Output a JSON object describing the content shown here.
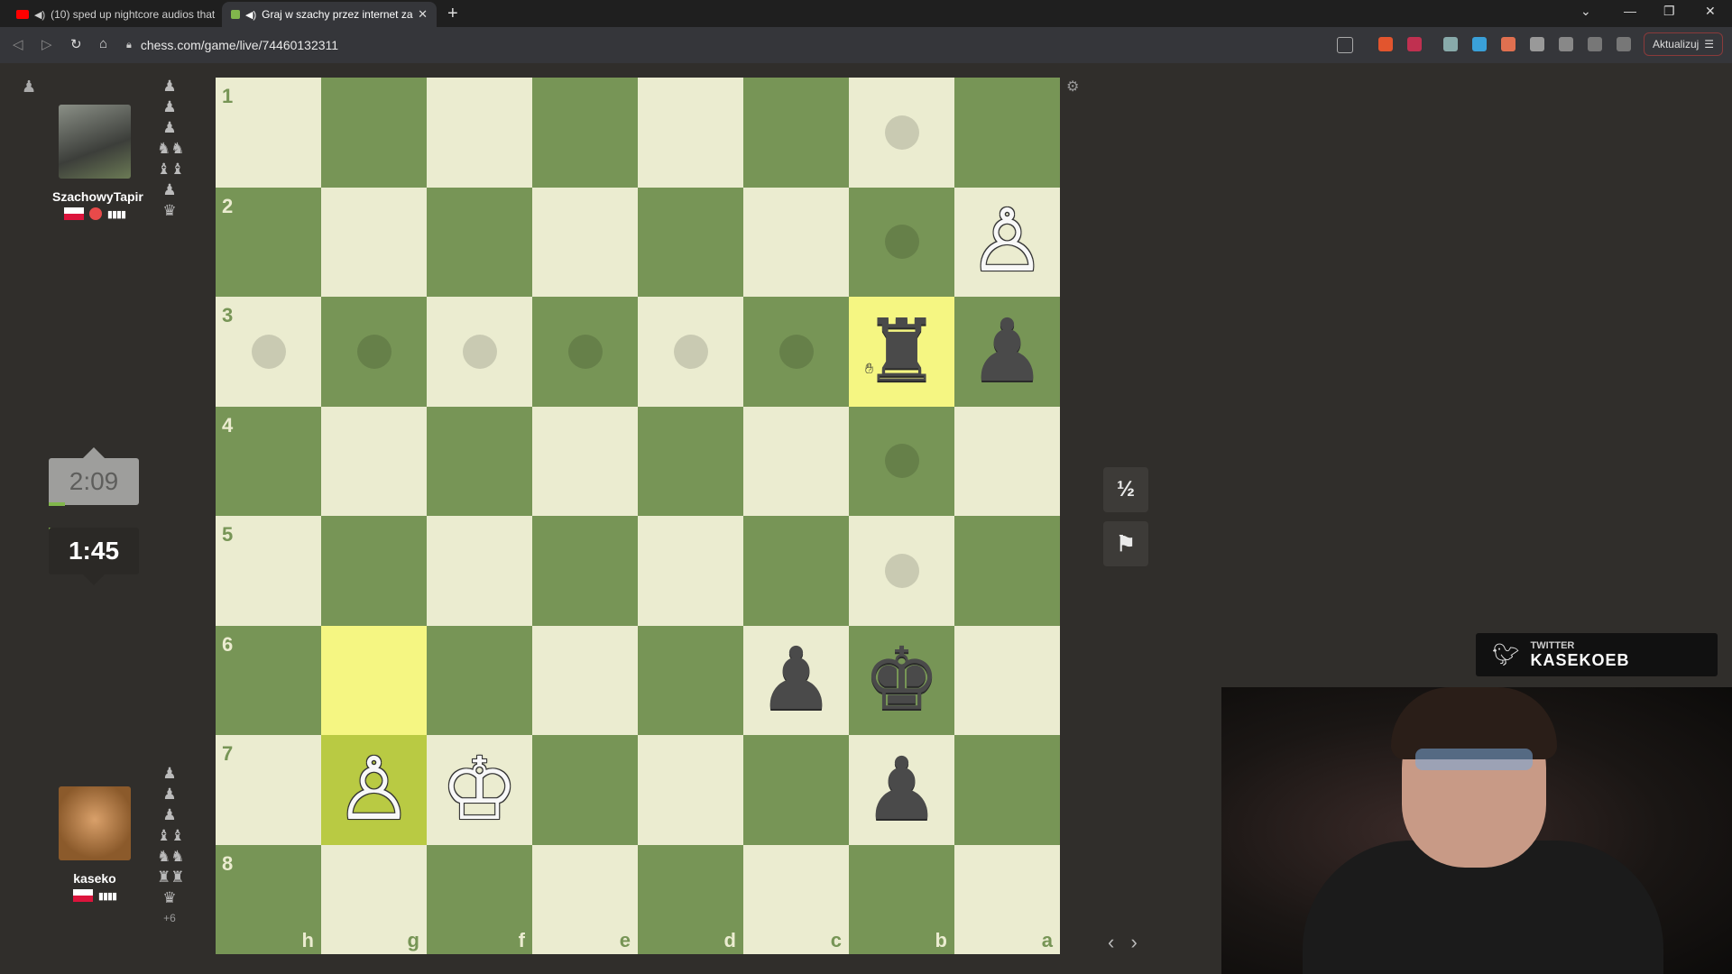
{
  "browser": {
    "tabs": [
      {
        "title": "(10) sped up nightcore audios that",
        "active": false,
        "favicon": "youtube-icon"
      },
      {
        "title": "Graj w szachy przez internet za",
        "active": true,
        "favicon": "chess-pawn-icon"
      }
    ],
    "url": "chess.com/game/live/74460132311",
    "update_label": "Aktualizuj"
  },
  "board": {
    "orientation": "black",
    "ranks": [
      "1",
      "2",
      "3",
      "4",
      "5",
      "6",
      "7",
      "8"
    ],
    "files": [
      "h",
      "g",
      "f",
      "e",
      "d",
      "c",
      "b",
      "a"
    ],
    "highlight_squares": [
      "b3",
      "g6"
    ],
    "lastmove_square": "g7",
    "move_dots": [
      "b1",
      "b2",
      "h3",
      "g3",
      "f3",
      "e3",
      "d3",
      "c3",
      "b4",
      "b5"
    ],
    "pieces": [
      {
        "square": "a2",
        "piece": "pawn",
        "color": "white"
      },
      {
        "square": "b3",
        "piece": "rook",
        "color": "black"
      },
      {
        "square": "a3",
        "piece": "pawn",
        "color": "black"
      },
      {
        "square": "c6",
        "piece": "pawn",
        "color": "black"
      },
      {
        "square": "b6",
        "piece": "king",
        "color": "black"
      },
      {
        "square": "g7",
        "piece": "pawn",
        "color": "white"
      },
      {
        "square": "f7",
        "piece": "king",
        "color": "white"
      },
      {
        "square": "b7",
        "piece": "pawn",
        "color": "black"
      }
    ]
  },
  "opponent": {
    "name": "SzachowyTapir",
    "country": "Poland",
    "clock": "2:09",
    "captured": [
      "♟",
      "♟",
      "♟",
      "♞♞",
      "♝♝",
      "♟",
      "♛"
    ]
  },
  "player": {
    "name": "kaseko",
    "country": "Poland",
    "clock": "1:45",
    "captured": [
      "♟",
      "♟",
      "♟",
      "♝♝",
      "♞♞",
      "♜♜",
      "♛"
    ],
    "material_advantage": "+6"
  },
  "controls": {
    "draw_label": "½",
    "resign_icon": "flag-icon",
    "nav_arrows": "‹ ›"
  },
  "overlay": {
    "twitter_label": "TWITTER",
    "twitter_handle": "KASEKOEB"
  },
  "colors": {
    "light_square": "#ebecd0",
    "dark_square": "#779556",
    "highlight": "#f5f682",
    "lastmove": "#b9ca43",
    "background": "#302e2b"
  }
}
